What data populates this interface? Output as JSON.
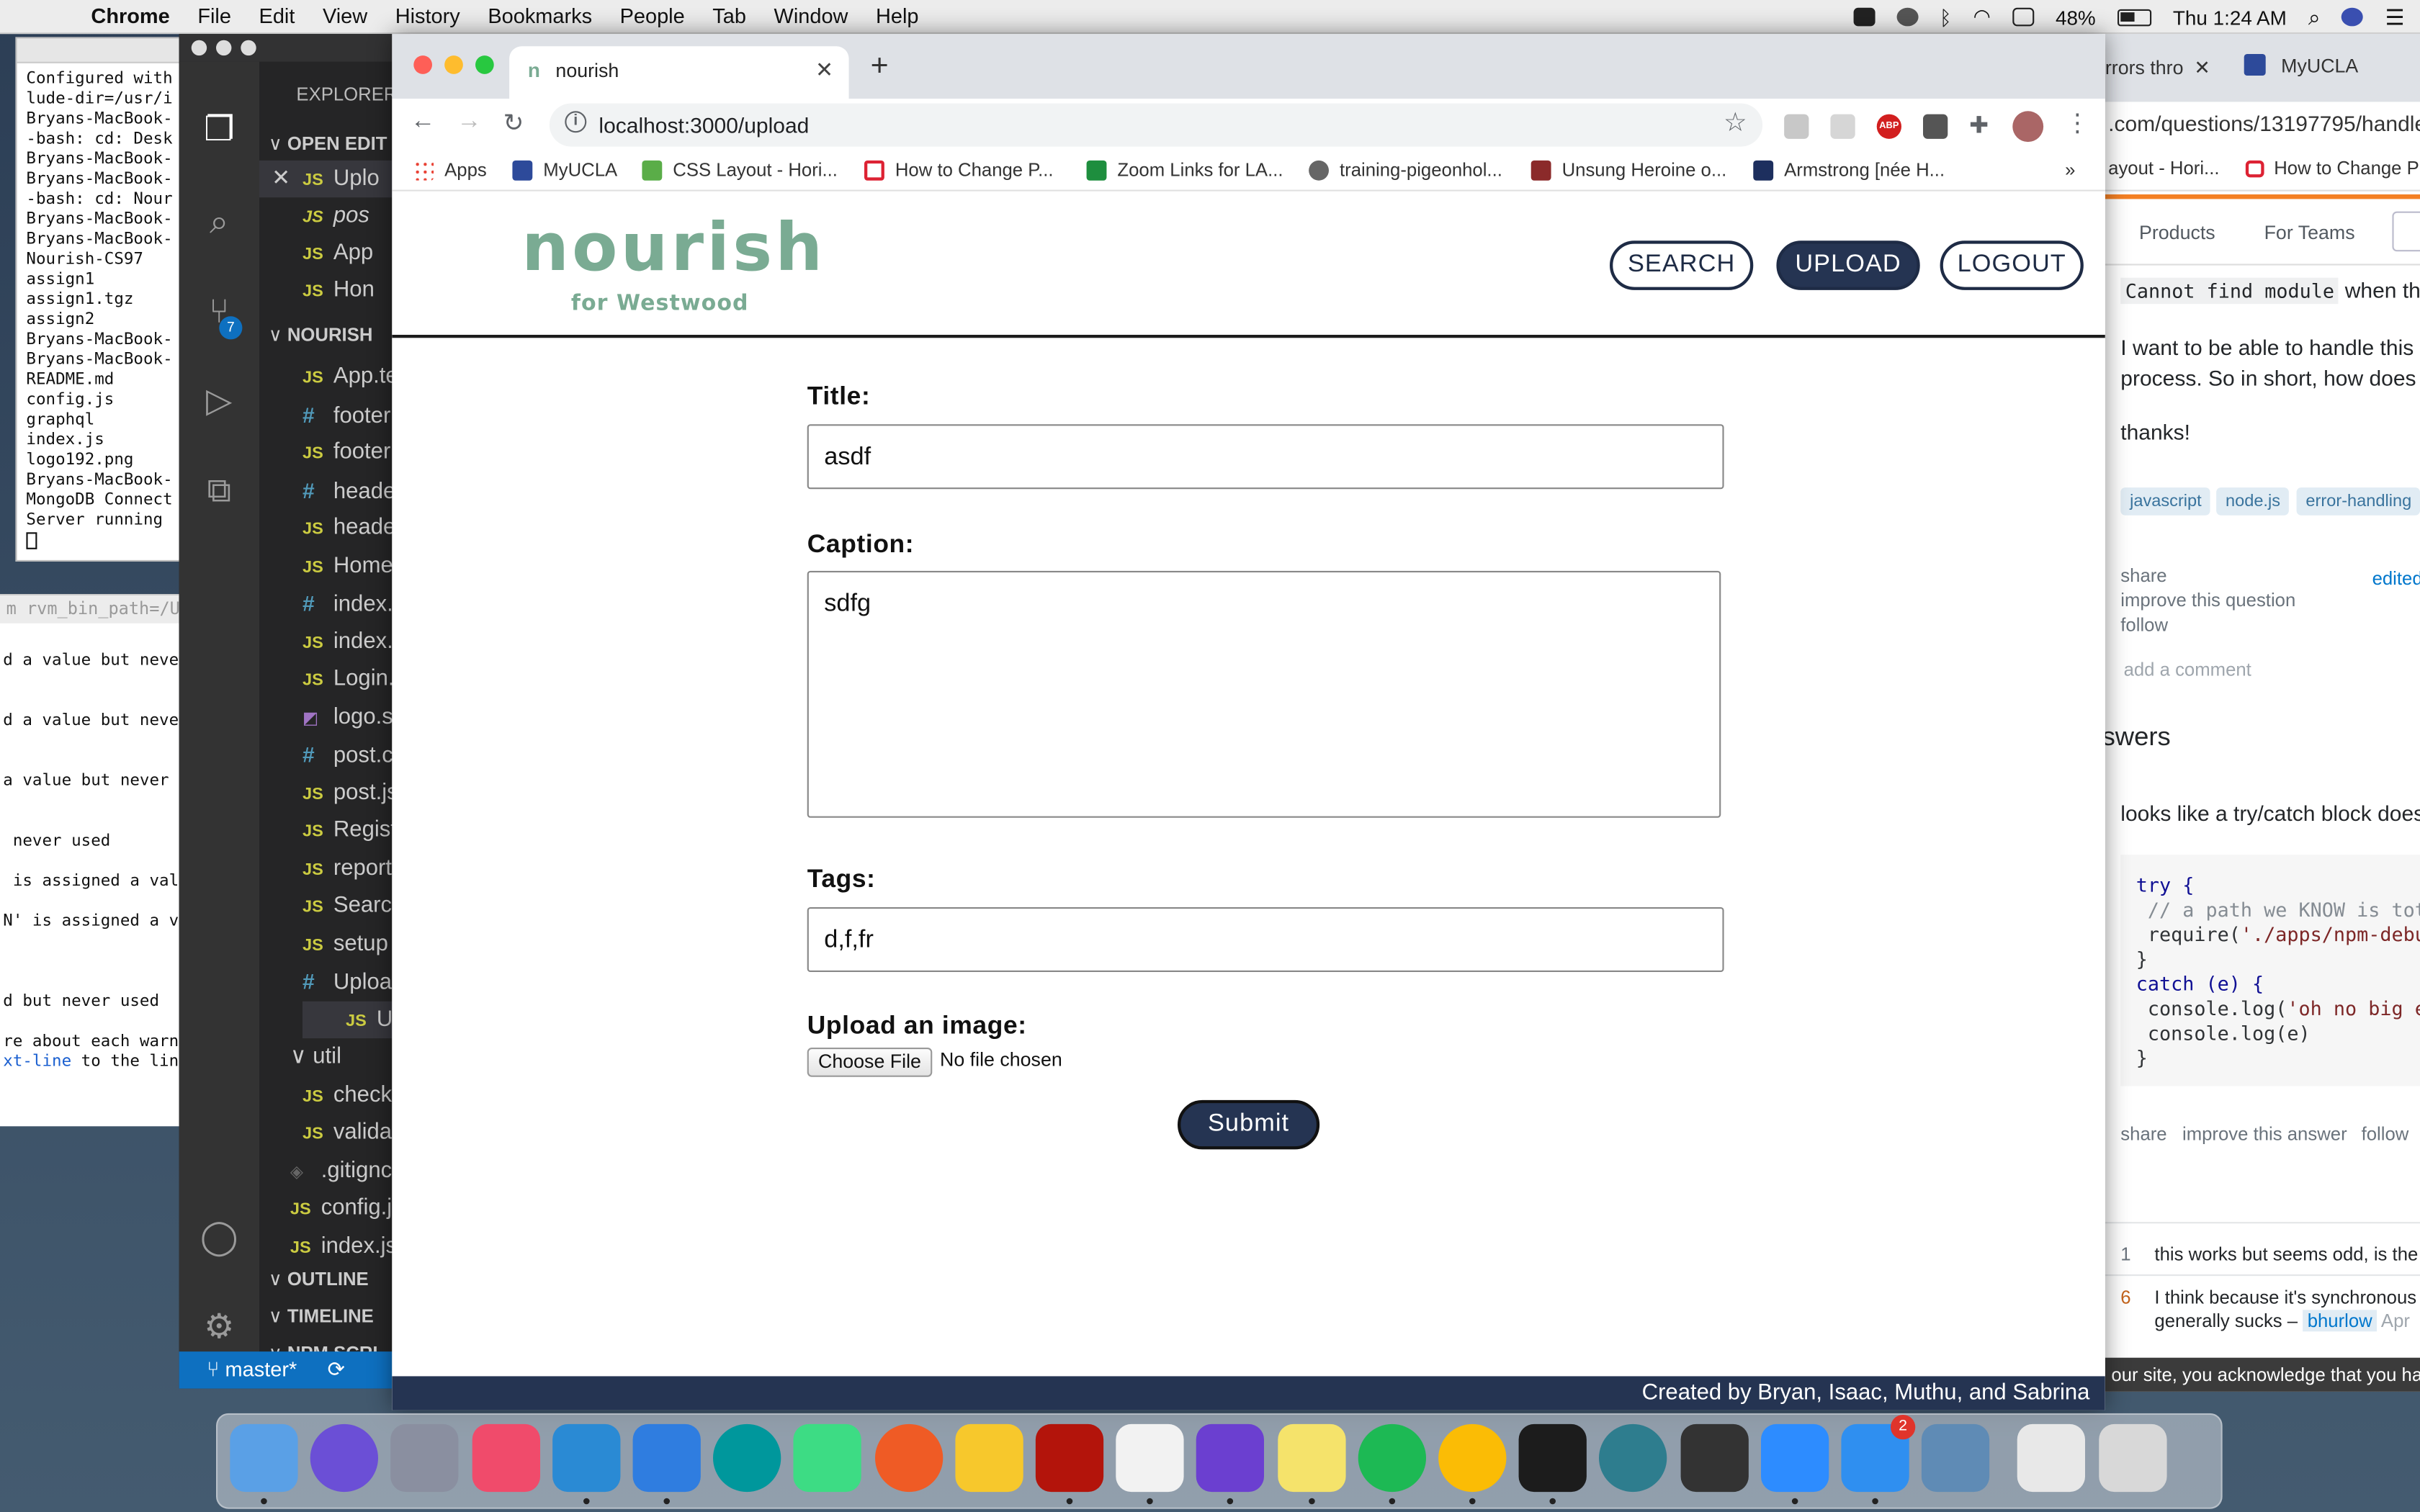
{
  "menubar": {
    "app": "Chrome",
    "items": [
      "File",
      "Edit",
      "View",
      "History",
      "Bookmarks",
      "People",
      "Tab",
      "Window",
      "Help"
    ],
    "battery": "48%",
    "clock": "Thu 1:24 AM"
  },
  "terminal": {
    "lines": [
      "Configured with",
      "lude-dir=/usr/i",
      "Bryans-MacBook-",
      "-bash: cd: Desk",
      "Bryans-MacBook-",
      "Bryans-MacBook-",
      "-bash: cd: Nour",
      "Bryans-MacBook-",
      "Bryans-MacBook-",
      "Nourish-CS97",
      "assign1",
      "assign1.tgz",
      "assign2",
      "Bryans-MacBook-",
      "Bryans-MacBook-",
      "README.md",
      "config.js",
      "graphql",
      "index.js",
      "logo192.png",
      "Bryans-MacBook-",
      "MongoDB Connect",
      "Server running"
    ],
    "lower_head": "m rvm_bin_path=/Use",
    "lower_lines": [
      "d a value but neve",
      "d a value but neve",
      "a value but never",
      " never used",
      " is assigned a val",
      "N' is assigned a v",
      "d but never used",
      "re about each warn",
      "xt-line",
      " to the lin"
    ]
  },
  "vscode": {
    "explorer_title": "EXPLORER",
    "open_editors": "OPEN EDIT",
    "open_files": [
      {
        "type": "JS",
        "name": "Uplo",
        "selected": true
      },
      {
        "type": "JS",
        "name": "pos",
        "italic": true
      },
      {
        "type": "JS",
        "name": "App"
      },
      {
        "type": "JS",
        "name": "Hon"
      }
    ],
    "project": "NOURISH",
    "files": [
      {
        "type": "JS",
        "name": "App.te"
      },
      {
        "type": "#",
        "name": "footer"
      },
      {
        "type": "JS",
        "name": "footer"
      },
      {
        "type": "#",
        "name": "heade"
      },
      {
        "type": "JS",
        "name": "heade"
      },
      {
        "type": "JS",
        "name": "Home"
      },
      {
        "type": "#",
        "name": "index."
      },
      {
        "type": "JS",
        "name": "index."
      },
      {
        "type": "JS",
        "name": "Login."
      },
      {
        "type": "img",
        "name": "logo.s"
      },
      {
        "type": "#",
        "name": "post.c"
      },
      {
        "type": "JS",
        "name": "post.js"
      },
      {
        "type": "JS",
        "name": "Regist"
      },
      {
        "type": "JS",
        "name": "report"
      },
      {
        "type": "JS",
        "name": "Searc"
      },
      {
        "type": "JS",
        "name": "setup"
      },
      {
        "type": "#",
        "name": "Uploa"
      },
      {
        "type": "JS",
        "name": "Uploa",
        "selected": true
      }
    ],
    "folder_util": "util",
    "util_files": [
      {
        "type": "JS",
        "name": "check"
      },
      {
        "type": "JS",
        "name": "valida"
      }
    ],
    "root_files": [
      {
        "type": "git",
        "name": ".gitignc"
      },
      {
        "type": "JS",
        "name": "config.j"
      },
      {
        "type": "JS",
        "name": "index.js"
      }
    ],
    "sections": [
      "OUTLINE",
      "TIMELINE",
      "NPM SCRI"
    ],
    "scm_badge": "7",
    "branch": "master*"
  },
  "chrome": {
    "tab_title": "nourish",
    "tab_favicon": "n",
    "url": "localhost:3000/upload",
    "bookmarks": [
      "Apps",
      "MyUCLA",
      "CSS Layout - Hori...",
      "How to Change P...",
      "Zoom Links for LA...",
      "training-pigeonhol...",
      "Unsung Heroine o...",
      "Armstrong [née H..."
    ],
    "more_bookmarks": "»",
    "extension_abp": "ABP"
  },
  "page": {
    "logo": "nourish",
    "logo_sub": "for Westwood",
    "nav": {
      "search": "SEARCH",
      "upload": "UPLOAD",
      "logout": "LOGOUT"
    },
    "form": {
      "title_label": "Title:",
      "title_value": "asdf",
      "caption_label": "Caption:",
      "caption_value": "sdfg",
      "tags_label": "Tags:",
      "tags_value": "d,f,fr",
      "image_label": "Upload an image:",
      "file_button": "Choose File",
      "file_status": "No file chosen",
      "submit": "Submit"
    },
    "footer": "Created by Bryan, Isaac, Muthu, and Sabrina"
  },
  "stackoverflow": {
    "tab1": "rrors thro",
    "tab2": "MyUCLA",
    "url": ".com/questions/13197795/handle",
    "bookmarks": [
      "ayout - Hori...",
      "How to Change P"
    ],
    "nav": [
      "Products",
      "For Teams"
    ],
    "cut_text": "cannot find module when the",
    "code_inline": "Cannot find module",
    "after_code": "when the",
    "para1a": "I want to be able to handle this",
    "para1b": "process. So in short, how does",
    "thanks": "thanks!",
    "tags": [
      "javascript",
      "node.js",
      "error-handling"
    ],
    "share": "share",
    "improve": "improve this question",
    "follow": "follow",
    "edited": "edited",
    "add_comment": "add a comment",
    "answers_heading": "swers",
    "answer_text": "looks like a try/catch block does",
    "code": {
      "l1": "try {",
      "l2": " // a path we KNOW is tot",
      "l3a": " require(",
      "l3b": "'./apps/npm-debu",
      "l4": "}",
      "l5": "catch (e) {",
      "l6a": " console.log(",
      "l6b": "'oh no big e",
      "l7": " console.log(e)",
      "l8": "}"
    },
    "answer_actions": [
      "share",
      "improve this answer",
      "follow"
    ],
    "comments": [
      {
        "votes": "1",
        "text": "this works but seems odd, is the"
      },
      {
        "votes": "6",
        "text": "I think because it's synchronous",
        "text2": "generally sucks –",
        "user": "bhurlow",
        "date": "Apr"
      }
    ],
    "cookie": "our site, you acknowledge that you ha"
  },
  "dock": {
    "apps": [
      "finder",
      "siri",
      "launchpad",
      "itunes",
      "vscode",
      "xcode",
      "arduino",
      "android-studio",
      "postman",
      "cyberduck",
      "filezilla",
      "textedit",
      "imovie",
      "stickies",
      "spotify",
      "chrome",
      "terminal",
      "network",
      "piano",
      "zoom",
      "messages",
      "preview",
      "documents",
      "trash"
    ],
    "messages_badge": "2"
  },
  "colors": {
    "brand_green": "#7aab93",
    "navy": "#253452",
    "vscode_blue": "#0e70c0"
  }
}
